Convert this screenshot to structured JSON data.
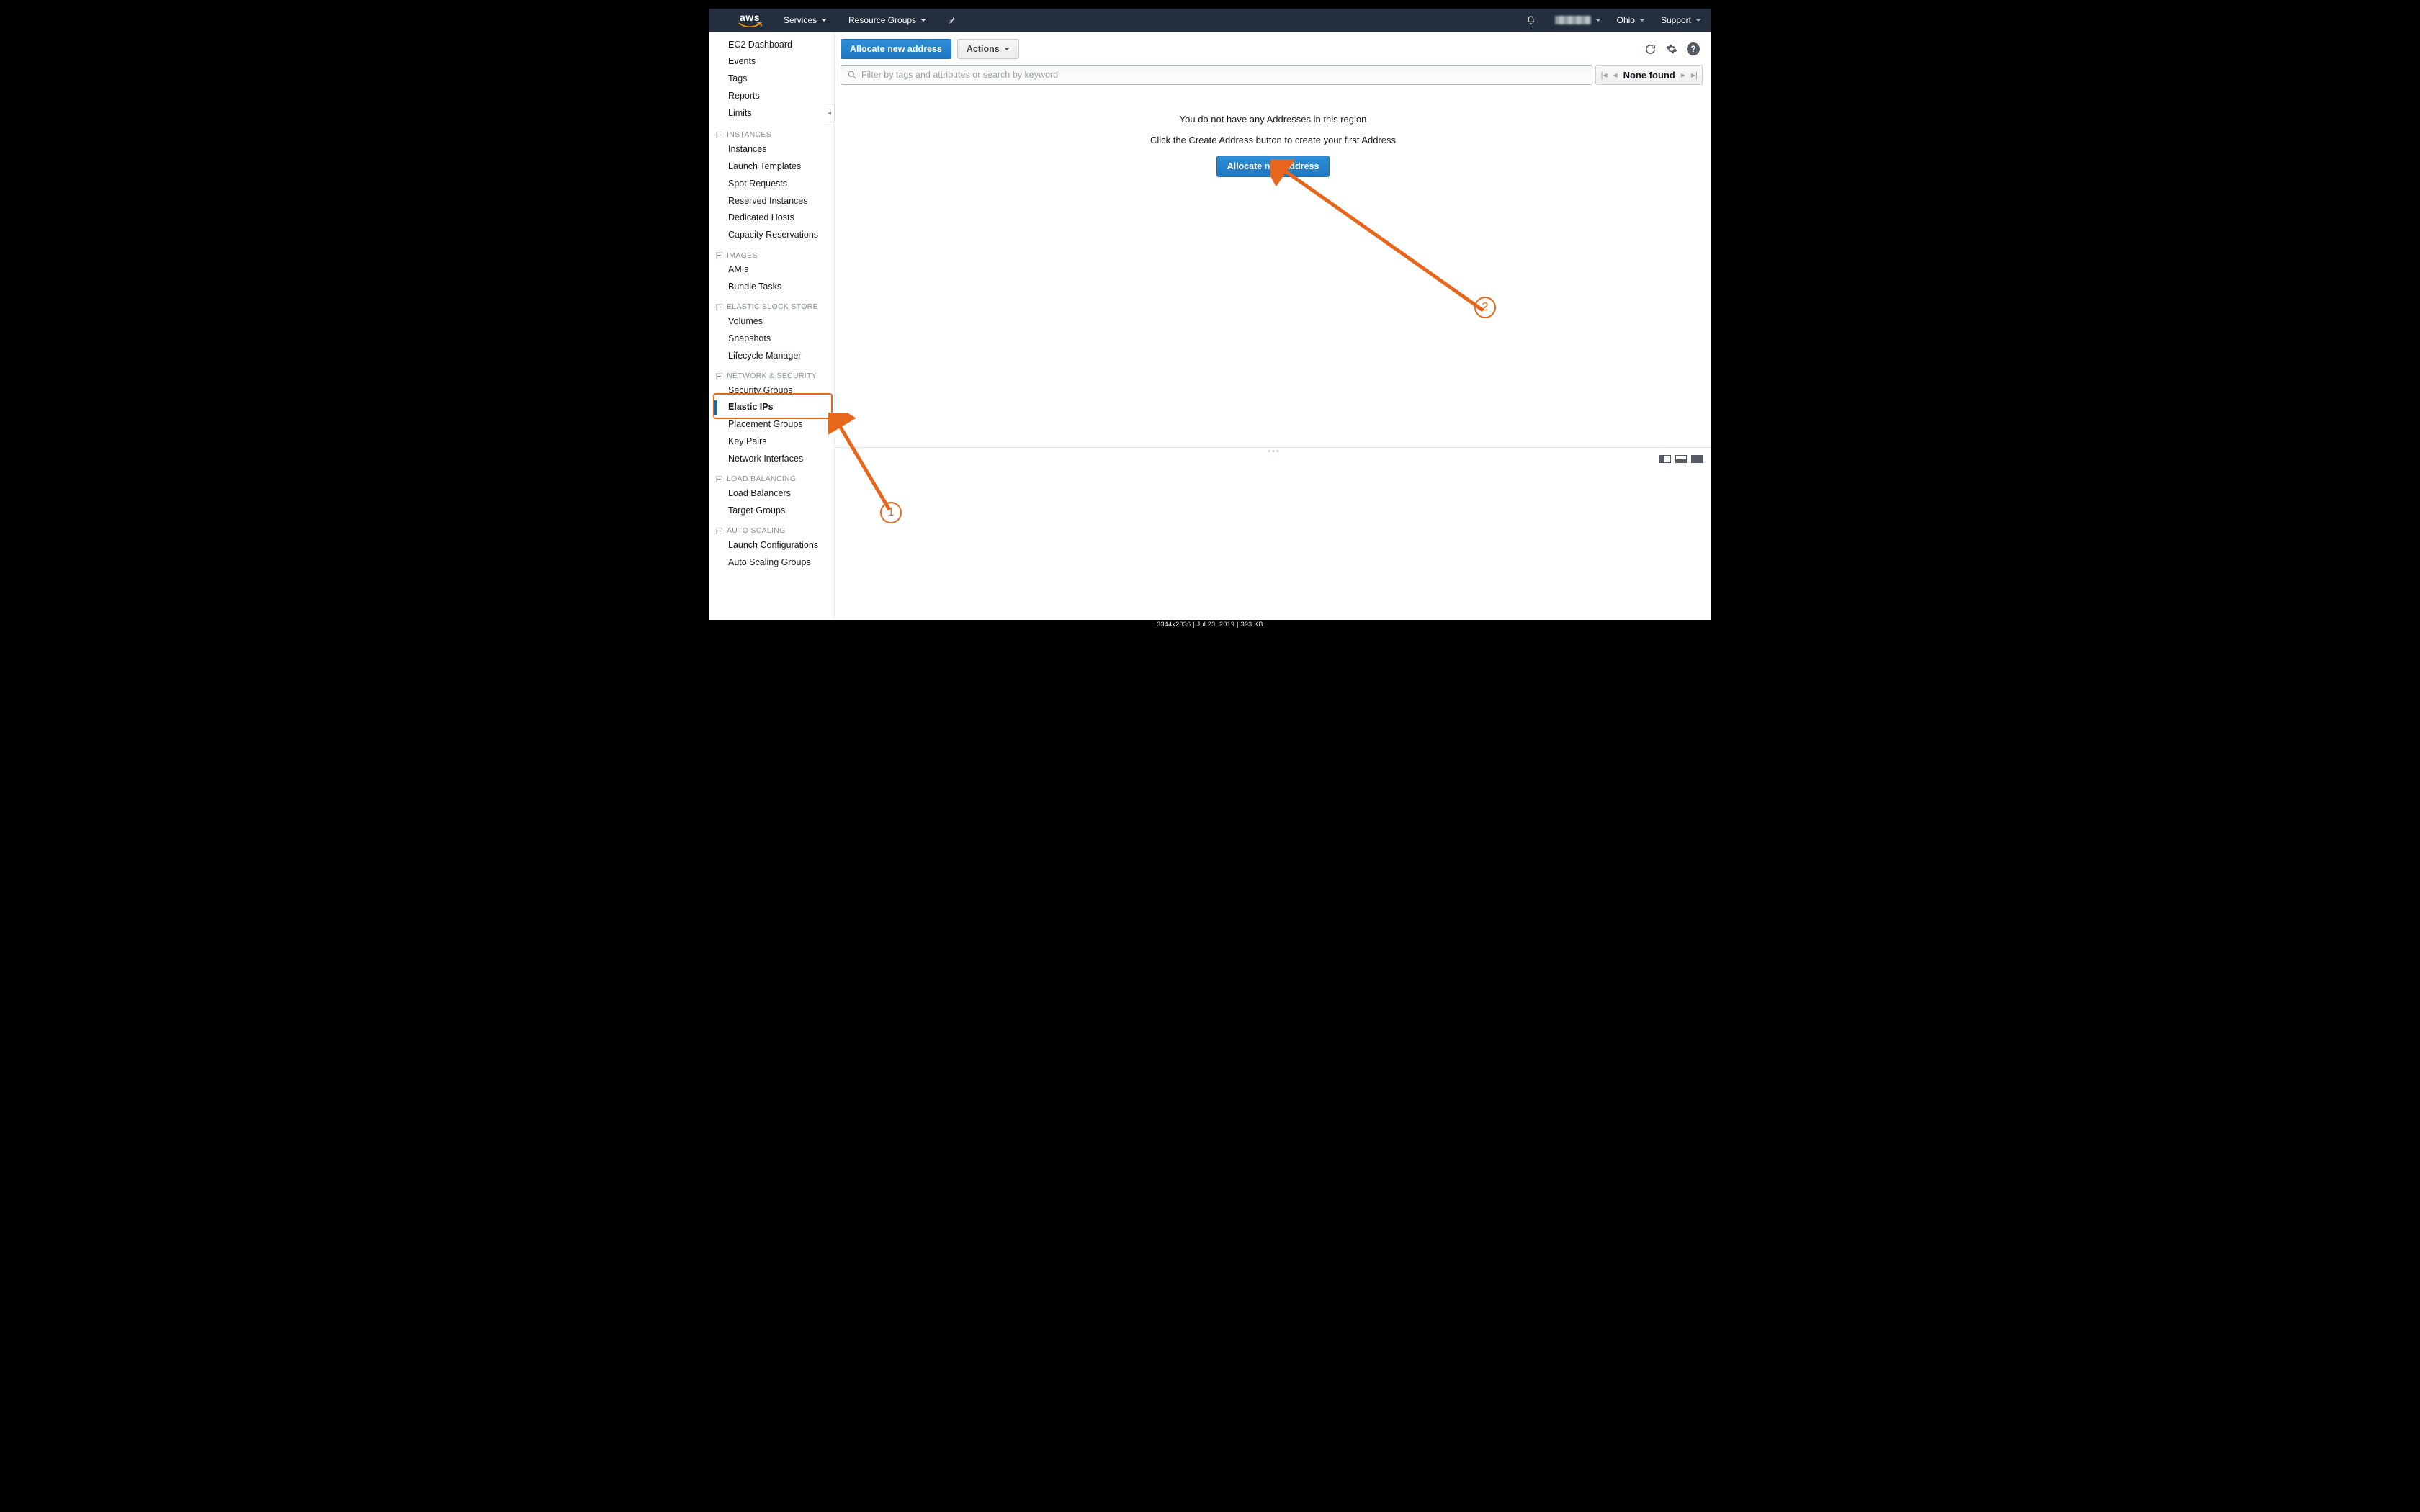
{
  "top": {
    "services": "Services",
    "resource_groups": "Resource Groups",
    "region": "Ohio",
    "support": "Support"
  },
  "sidebar": {
    "top_links": [
      "EC2 Dashboard",
      "Events",
      "Tags",
      "Reports",
      "Limits"
    ],
    "groups": [
      {
        "header": "INSTANCES",
        "items": [
          "Instances",
          "Launch Templates",
          "Spot Requests",
          "Reserved Instances",
          "Dedicated Hosts",
          "Capacity Reservations"
        ]
      },
      {
        "header": "IMAGES",
        "items": [
          "AMIs",
          "Bundle Tasks"
        ]
      },
      {
        "header": "ELASTIC BLOCK STORE",
        "items": [
          "Volumes",
          "Snapshots",
          "Lifecycle Manager"
        ]
      },
      {
        "header": "NETWORK & SECURITY",
        "items": [
          "Security Groups",
          "Elastic IPs",
          "Placement Groups",
          "Key Pairs",
          "Network Interfaces"
        ]
      },
      {
        "header": "LOAD BALANCING",
        "items": [
          "Load Balancers",
          "Target Groups"
        ]
      },
      {
        "header": "AUTO SCALING",
        "items": [
          "Launch Configurations",
          "Auto Scaling Groups"
        ]
      }
    ],
    "active": "Elastic IPs"
  },
  "toolbar": {
    "allocate": "Allocate new address",
    "actions": "Actions"
  },
  "search": {
    "placeholder": "Filter by tags and attributes or search by keyword"
  },
  "pager": {
    "status": "None found"
  },
  "empty": {
    "line1": "You do not have any Addresses in this region",
    "line2": "Click the Create Address button to create your first Address",
    "button": "Allocate new address"
  },
  "annotations": {
    "n1": "1",
    "n2": "2"
  },
  "footer": "3344x2036 | Jul 23, 2019 | 393 KB"
}
